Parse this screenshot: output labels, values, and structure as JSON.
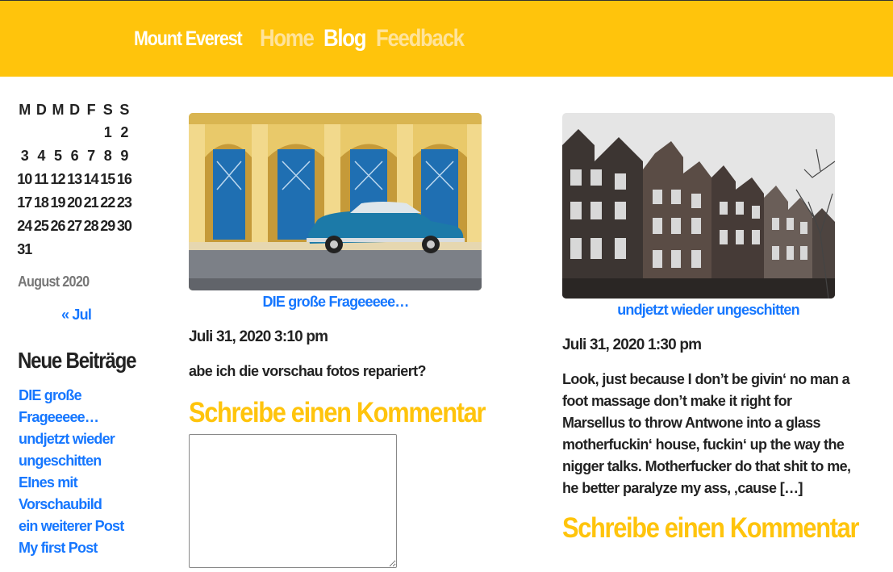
{
  "header": {
    "brand": "Mount Everest",
    "nav": [
      {
        "label": "Home"
      },
      {
        "label": "Blog"
      },
      {
        "label": "Feedback"
      }
    ],
    "background_color": "#ffc40c"
  },
  "calendar": {
    "weekdays": [
      "M",
      "D",
      "M",
      "D",
      "F",
      "S",
      "S"
    ],
    "weeks": [
      [
        "",
        "",
        "",
        "",
        "",
        "1",
        "2"
      ],
      [
        "3",
        "4",
        "5",
        "6",
        "7",
        "8",
        "9"
      ],
      [
        "10",
        "11",
        "12",
        "13",
        "14",
        "15",
        "16"
      ],
      [
        "17",
        "18",
        "19",
        "20",
        "21",
        "22",
        "23"
      ],
      [
        "24",
        "25",
        "26",
        "27",
        "28",
        "29",
        "30"
      ],
      [
        "31",
        "",
        "",
        "",
        "",
        "",
        ""
      ]
    ],
    "caption": "August 2020",
    "prev_link": "« Jul"
  },
  "sidebar": {
    "heading": "Neue Beiträge",
    "recent_posts": [
      {
        "label": "DIE große"
      },
      {
        "label": "Frageeeee…"
      },
      {
        "label": "undjetzt wieder"
      },
      {
        "label": "ungeschitten"
      },
      {
        "label": "EInes mit"
      },
      {
        "label": "Vorschaubild"
      },
      {
        "label": "ein weiterer Post"
      },
      {
        "label": "My first Post"
      }
    ]
  },
  "posts": [
    {
      "image_icon": "vintage-car-photo",
      "title": "DIE große Frageeeee…",
      "date": "Juli 31, 2020 3:10 pm",
      "excerpt": "abe ich die vorschau fotos repariert?",
      "comment_heading": "Schreibe einen Kommentar"
    },
    {
      "image_icon": "canal-houses-photo",
      "title": "undjetzt wieder ungeschitten",
      "date": "Juli 31, 2020 1:30 pm",
      "excerpt": "Look, just because I don’t be givin‘ no man a foot massage don’t make it right for Marsellus to throw Antwone into a glass motherfuckin‘ house, fuckin‘ up the way the nigger talks. Motherfucker do that shit to me, he better paralyze my ass, ‚cause […]",
      "comment_heading": "Schreibe einen Kommentar"
    }
  ],
  "colors": {
    "accent": "#ffc40c",
    "link": "#1677ff",
    "text": "#222222"
  }
}
